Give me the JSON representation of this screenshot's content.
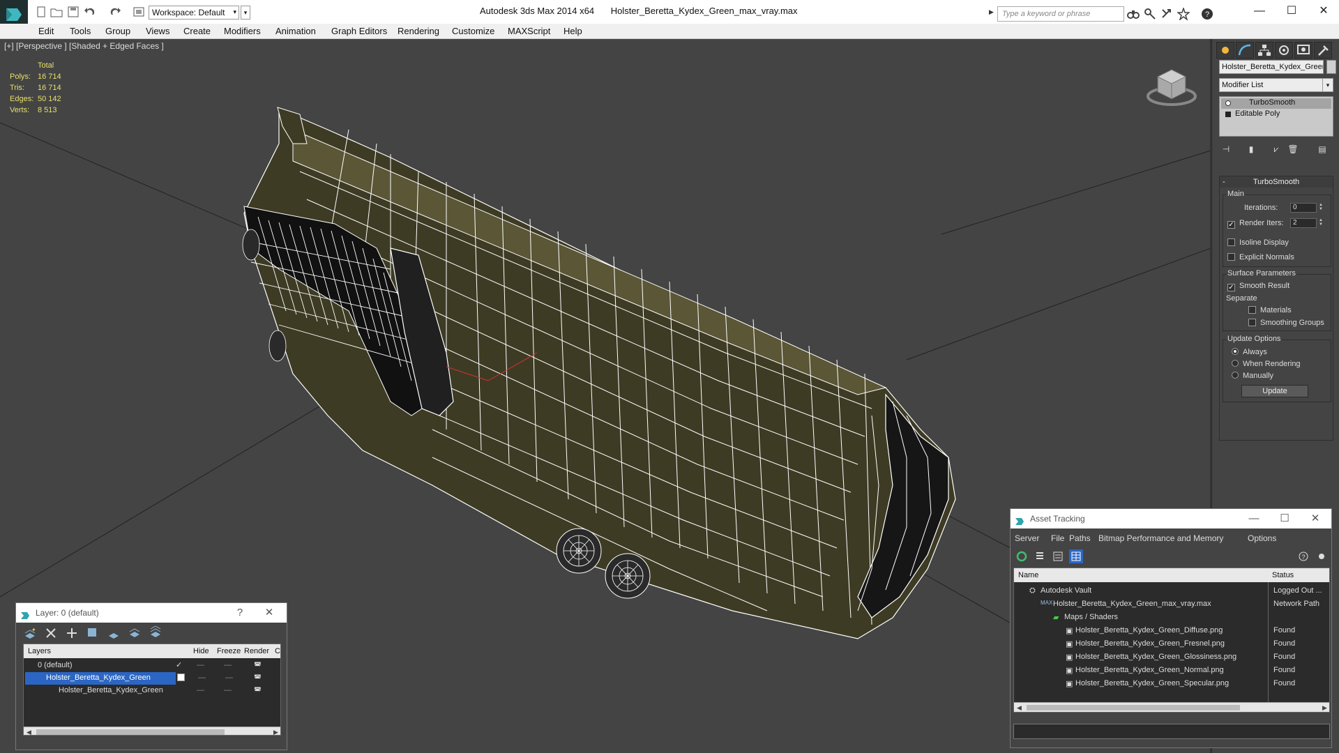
{
  "titlebar": {
    "app_title": "Autodesk 3ds Max  2014 x64",
    "file_name": "Holster_Beretta_Kydex_Green_max_vray.max",
    "workspace_label": "Workspace: Default",
    "search_placeholder": "Type a keyword or phrase"
  },
  "menu": [
    "Edit",
    "Tools",
    "Group",
    "Views",
    "Create",
    "Modifiers",
    "Animation",
    "Graph Editors",
    "Rendering",
    "Customize",
    "MAXScript",
    "Help"
  ],
  "viewport": {
    "label": "[+] [Perspective ] [Shaded + Edged Faces ]",
    "stats_header": "Total",
    "stats": [
      {
        "label": "Polys:",
        "value": "16 714"
      },
      {
        "label": "Tris:",
        "value": "16 714"
      },
      {
        "label": "Edges:",
        "value": "50 142"
      },
      {
        "label": "Verts:",
        "value": "8 513"
      }
    ],
    "colors": {
      "background": "#444444",
      "mesh_fill": "#3e3b24",
      "wire": "#ffffff",
      "stats_text": "#e6e06a"
    }
  },
  "command_panel": {
    "object_name": "Holster_Beretta_Kydex_Green",
    "modifier_list": "Modifier List",
    "stack": [
      "TurboSmooth",
      "Editable Poly"
    ],
    "rollout_title": "TurboSmooth",
    "main_group": "Main",
    "iterations_label": "Iterations:",
    "iterations_value": "0",
    "render_iters_label": "Render Iters:",
    "render_iters_value": "2",
    "render_iters_checked": true,
    "isoline_label": "Isoline Display",
    "explicit_normals_label": "Explicit Normals",
    "surface_group": "Surface Parameters",
    "smooth_result_label": "Smooth Result",
    "separate_label": "Separate",
    "materials_label": "Materials",
    "smoothing_groups_label": "Smoothing Groups",
    "update_group": "Update Options",
    "update_options": [
      "Always",
      "When Rendering",
      "Manually"
    ],
    "update_selected": "Always",
    "update_button": "Update"
  },
  "layer_window": {
    "title": "Layer: 0 (default)",
    "help": "?",
    "columns": [
      "Layers",
      "Hide",
      "Freeze",
      "Render",
      "C"
    ],
    "rows": [
      {
        "name": "0 (default)",
        "indent": 0,
        "selected": false
      },
      {
        "name": "Holster_Beretta_Kydex_Green",
        "indent": 0,
        "selected": true
      },
      {
        "name": "Holster_Beretta_Kydex_Green",
        "indent": 1,
        "selected": false
      }
    ]
  },
  "asset_window": {
    "title": "Asset Tracking",
    "menu": [
      "Server",
      "File",
      "Paths",
      "Bitmap Performance and Memory",
      "Options"
    ],
    "columns": [
      "Name",
      "Status"
    ],
    "rows": [
      {
        "name": "Autodesk Vault",
        "status": "Logged Out ...",
        "indent": 1
      },
      {
        "name": "Holster_Beretta_Kydex_Green_max_vray.max",
        "status": "Network Path",
        "indent": 2
      },
      {
        "name": "Maps / Shaders",
        "status": "",
        "indent": 3
      },
      {
        "name": "Holster_Beretta_Kydex_Green_Diffuse.png",
        "status": "Found",
        "indent": 4
      },
      {
        "name": "Holster_Beretta_Kydex_Green_Fresnel.png",
        "status": "Found",
        "indent": 4
      },
      {
        "name": "Holster_Beretta_Kydex_Green_Glossiness.png",
        "status": "Found",
        "indent": 4
      },
      {
        "name": "Holster_Beretta_Kydex_Green_Normal.png",
        "status": "Found",
        "indent": 4
      },
      {
        "name": "Holster_Beretta_Kydex_Green_Specular.png",
        "status": "Found",
        "indent": 4
      }
    ]
  },
  "icons": [
    "app-logo-icon",
    "new-file-icon",
    "open-file-icon",
    "save-icon",
    "undo-icon",
    "redo-icon",
    "binoculars-icon",
    "key-icon",
    "star-icon",
    "help-icon",
    "view-cube-icon",
    "sun-icon",
    "curve-icon",
    "hierarchy-icon",
    "motion-icon",
    "display-icon",
    "hammer-icon"
  ]
}
